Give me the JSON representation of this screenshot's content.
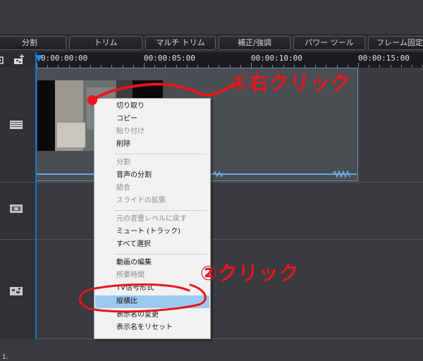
{
  "toolbar": {
    "buttons": [
      {
        "label": "分割"
      },
      {
        "label": "トリム"
      },
      {
        "label": "マルチ トリム"
      },
      {
        "label": "補正/強調"
      },
      {
        "label": "パワー ツール"
      },
      {
        "label": "フレーム固定"
      }
    ]
  },
  "timeline": {
    "timecodes": [
      "0:00:00:00",
      "00:00:05:00",
      "00:00:10:00",
      "00:00:15:00"
    ],
    "track_number": "1."
  },
  "context_menu": {
    "groups": [
      [
        {
          "label": "切り取り",
          "enabled": true
        },
        {
          "label": "コピー",
          "enabled": true
        },
        {
          "label": "貼り付け",
          "enabled": false
        },
        {
          "label": "削除",
          "enabled": true
        }
      ],
      [
        {
          "label": "分割",
          "enabled": false
        },
        {
          "label": "音声の分割",
          "enabled": true
        },
        {
          "label": "結合",
          "enabled": false
        },
        {
          "label": "スライドの拡張",
          "enabled": false
        }
      ],
      [
        {
          "label": "元の音量レベルに戻す",
          "enabled": false
        },
        {
          "label": "ミュート (トラック)",
          "enabled": true
        },
        {
          "label": "すべて選択",
          "enabled": true
        }
      ],
      [
        {
          "label": "動画の編集",
          "enabled": true
        },
        {
          "label": "所要時間",
          "enabled": false
        },
        {
          "label": "TV信号形式",
          "enabled": true
        },
        {
          "label": "縦横比",
          "enabled": true,
          "highlighted": true
        },
        {
          "label": "表示名の変更",
          "enabled": true
        },
        {
          "label": "表示名をリセット",
          "enabled": true
        }
      ]
    ]
  },
  "annotations": {
    "step1": "①右クリック",
    "step2": "②クリック",
    "color": "#e8151c"
  },
  "colors": {
    "playhead": "#1e6fd6",
    "clip_border": "#6e8fb0",
    "menu_highlight": "#9cc9ef"
  }
}
